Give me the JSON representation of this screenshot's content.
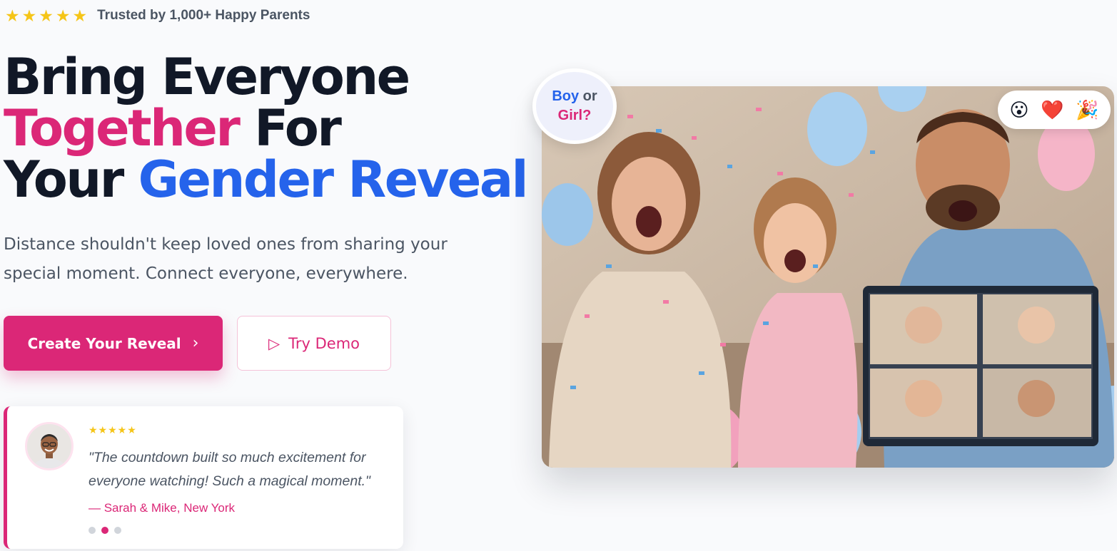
{
  "trust": {
    "stars": "★★★★★",
    "text": "Trusted by 1,000+ Happy Parents"
  },
  "hero": {
    "line1": "Bring Everyone",
    "line2_highlight": "Together",
    "line2_rest": " For",
    "line3_lead": "Your ",
    "line3_highlight": "Gender Reveal",
    "subtitle": "Distance shouldn't keep loved ones from sharing your special moment. Connect everyone, everywhere."
  },
  "buttons": {
    "primary_label": "Create Your Reveal",
    "primary_icon": "›",
    "secondary_label": "Try Demo",
    "secondary_icon": "▷"
  },
  "testimonial": {
    "stars": "★★★★★",
    "quote": "\"The countdown built so much excitement for everyone watching! Such a magical moment.\"",
    "author": "— Sarah & Mike, New York",
    "dots_total": 3,
    "active_dot_index": 1
  },
  "badge": {
    "boy": "Boy",
    "or": " or",
    "girl": "Girl?"
  },
  "reactions": [
    "😮",
    "❤️",
    "🎉"
  ],
  "colors": {
    "pink": "#db2777",
    "blue": "#2563eb",
    "dark": "#111827",
    "star": "#f5c518"
  }
}
